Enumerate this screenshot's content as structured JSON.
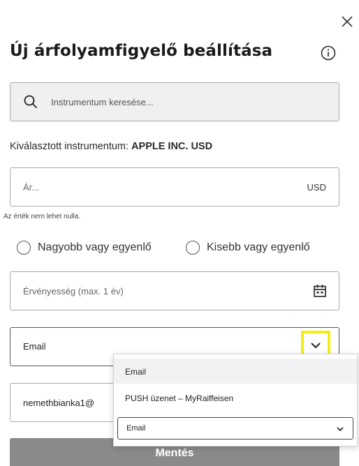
{
  "close_label": "Close",
  "header": {
    "title": "Új árfolyamfigyelő beállítása"
  },
  "search": {
    "placeholder": "Instrumentum keresése..."
  },
  "selected": {
    "label": "Kiválasztott instrumentum:",
    "value": "APPLE INC. USD"
  },
  "price": {
    "placeholder": "Ár...",
    "currency": "USD",
    "hint": "Az érték nem lehet nulla."
  },
  "direction": {
    "options": [
      "Nagyobb vagy egyenlő",
      "Kisebb vagy egyenlő"
    ],
    "selected": null
  },
  "validity": {
    "placeholder": "Érvényesség (max. 1 év)"
  },
  "channel": {
    "value": "Email",
    "options": [
      "Email",
      "PUSH üzenet – MyRaiffeisen"
    ],
    "native_select_value": "Email"
  },
  "email": {
    "value": "nemethbianka1@"
  },
  "save_label": "Mentés",
  "colors": {
    "highlight": "#f3ee12",
    "save_button": "#8a8a8a",
    "search_background": "#f0f0f0"
  },
  "icons": [
    "close-icon",
    "info-icon",
    "search-icon",
    "calendar-icon",
    "chevron-down-icon"
  ]
}
